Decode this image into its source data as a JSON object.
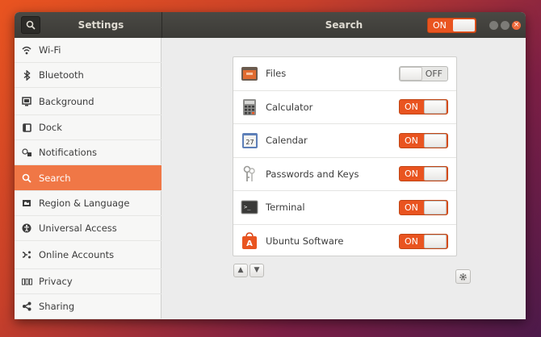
{
  "titlebar": {
    "left_title": "Settings",
    "main_title": "Search",
    "toggle_label": "ON",
    "window_controls": [
      "minimize-icon",
      "maximize-icon",
      "close-icon"
    ]
  },
  "sidebar": {
    "items": [
      {
        "label": "Wi-Fi",
        "icon": "wifi-icon"
      },
      {
        "label": "Bluetooth",
        "icon": "bluetooth-icon"
      },
      {
        "label": "Background",
        "icon": "background-icon"
      },
      {
        "label": "Dock",
        "icon": "dock-icon"
      },
      {
        "label": "Notifications",
        "icon": "notifications-icon"
      },
      {
        "label": "Search",
        "icon": "search-icon",
        "active": true
      },
      {
        "label": "Region & Language",
        "icon": "region-icon"
      },
      {
        "label": "Universal Access",
        "icon": "universal-access-icon"
      },
      {
        "label": "Online Accounts",
        "icon": "online-accounts-icon"
      },
      {
        "label": "Privacy",
        "icon": "privacy-icon"
      },
      {
        "label": "Sharing",
        "icon": "sharing-icon"
      }
    ]
  },
  "search_providers": [
    {
      "name": "Files",
      "icon": "files-icon",
      "state": "OFF"
    },
    {
      "name": "Calculator",
      "icon": "calculator-icon",
      "state": "ON"
    },
    {
      "name": "Calendar",
      "icon": "calendar-icon",
      "state": "ON",
      "icon_text": "27"
    },
    {
      "name": "Passwords and Keys",
      "icon": "keys-icon",
      "state": "ON"
    },
    {
      "name": "Terminal",
      "icon": "terminal-icon",
      "state": "ON",
      "icon_text": ">_"
    },
    {
      "name": "Ubuntu Software",
      "icon": "ubuntu-software-icon",
      "state": "ON",
      "icon_text": "A"
    }
  ],
  "colors": {
    "accent": "#e95420",
    "sidebar_active": "#f07746",
    "titlebar": "#3c3b37"
  }
}
